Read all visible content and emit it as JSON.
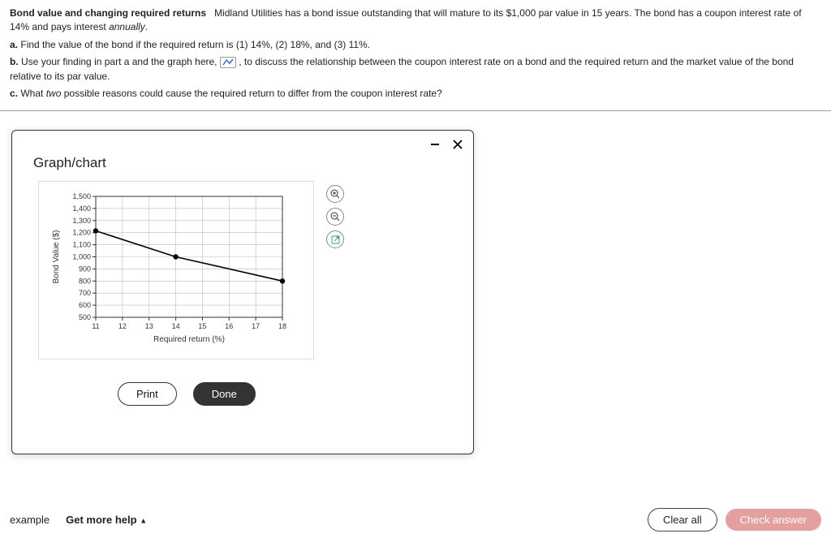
{
  "problem": {
    "title_bold": "Bond value and changing required returns",
    "intro_1": "Midland Utilities has a bond issue outstanding that will mature to its $1,000 par value in 15 years.  The bond has a coupon interest rate of 14% and pays interest ",
    "intro_em": "annually",
    "intro_2": ".",
    "a_label": "a.",
    "a_text": "Find the value of the bond if the required return is (1) 14%, (2) 18%, and (3) 11%.",
    "b_label": "b.",
    "b_text_1": "Use your finding in part a and the graph here, ",
    "b_text_2": ", to discuss the relationship between the coupon interest rate on a bond and the required return and the market value of the bond relative to its par value.",
    "c_label": "c.",
    "c_text_1": "What ",
    "c_em": "two",
    "c_text_2": " possible reasons could cause the required return to differ from the coupon interest rate?"
  },
  "modal": {
    "title": "Graph/chart",
    "print": "Print",
    "done": "Done"
  },
  "chart_data": {
    "type": "line",
    "title": "",
    "xlabel": "Required return (%)",
    "ylabel": "Bond Value ($)",
    "xlim": [
      11,
      18
    ],
    "ylim": [
      500,
      1500
    ],
    "x_ticks": [
      11,
      12,
      13,
      14,
      15,
      16,
      17,
      18
    ],
    "y_ticks": [
      500,
      600,
      700,
      800,
      900,
      1000,
      1100,
      1200,
      1300,
      1400,
      1500
    ],
    "series": [
      {
        "name": "Bond Value",
        "x": [
          11,
          14,
          18
        ],
        "y": [
          1215,
          1000,
          800
        ]
      }
    ]
  },
  "footer": {
    "example": "example",
    "help": "Get more help",
    "clear": "Clear all",
    "check": "Check answer"
  }
}
